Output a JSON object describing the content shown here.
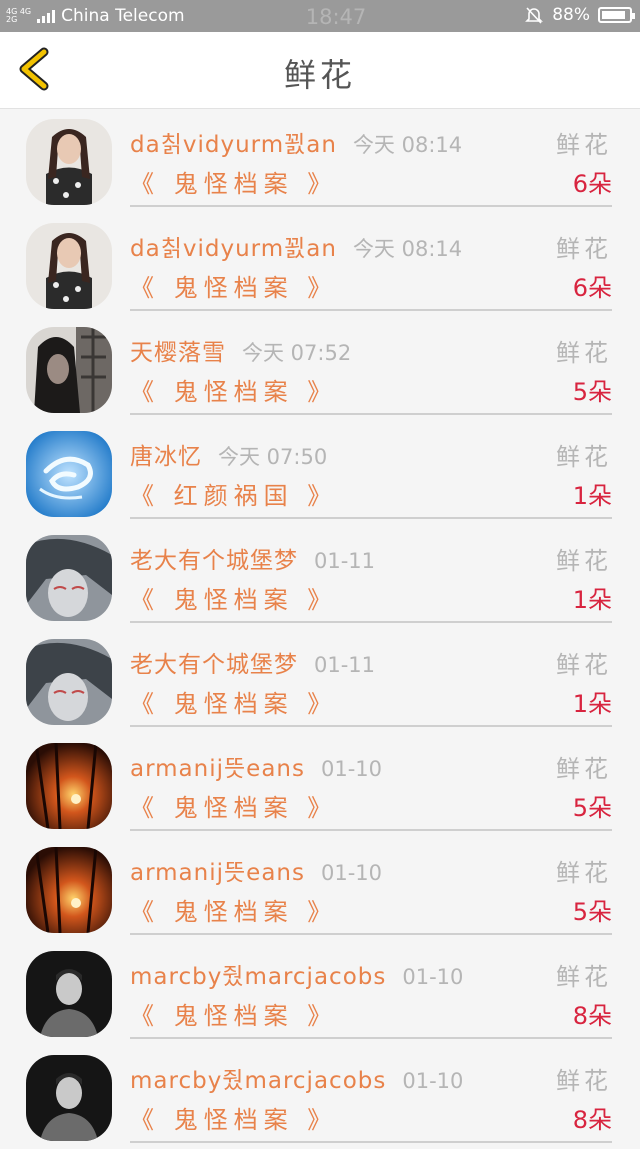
{
  "status_bar": {
    "network": "4G 4G",
    "network2": "2G",
    "carrier": "China Telecom",
    "time": "18:47",
    "battery": "88%",
    "battery_level": 0.88
  },
  "header": {
    "title": "鲜花"
  },
  "list": {
    "items": [
      {
        "name": "da칡vidyurm꾌an",
        "time": "今天 08:14",
        "book": "《 鬼怪档案 》",
        "label": "鲜花",
        "count": "6朵"
      },
      {
        "name": "da칡vidyurm꾌an",
        "time": "今天 08:14",
        "book": "《 鬼怪档案 》",
        "label": "鲜花",
        "count": "6朵"
      },
      {
        "name": "天樱落雪",
        "time": "今天 07:52",
        "book": "《 鬼怪档案 》",
        "label": "鲜花",
        "count": "5朵"
      },
      {
        "name": "唐冰忆",
        "time": "今天 07:50",
        "book": "《 红颜祸国 》",
        "label": "鲜花",
        "count": "1朵"
      },
      {
        "name": "老大有个城堡梦",
        "time": "01-11",
        "book": "《 鬼怪档案 》",
        "label": "鲜花",
        "count": "1朵"
      },
      {
        "name": "老大有个城堡梦",
        "time": "01-11",
        "book": "《 鬼怪档案 》",
        "label": "鲜花",
        "count": "1朵"
      },
      {
        "name": "armanij뜻eans",
        "time": "01-10",
        "book": "《 鬼怪档案 》",
        "label": "鲜花",
        "count": "5朵"
      },
      {
        "name": "armanij뜻eans",
        "time": "01-10",
        "book": "《 鬼怪档案 》",
        "label": "鲜花",
        "count": "5朵"
      },
      {
        "name": "marcby줬marcjacobs",
        "time": "01-10",
        "book": "《 鬼怪档案 》",
        "label": "鲜花",
        "count": "8朵"
      },
      {
        "name": "marcby줬marcjacobs",
        "time": "01-10",
        "book": "《 鬼怪档案 》",
        "label": "鲜花",
        "count": "8朵"
      }
    ]
  },
  "colors": {
    "accent_name": "#e8824a",
    "count_red": "#d8243f",
    "muted": "#b5b5b5",
    "back_arrow": "#f2c200"
  }
}
